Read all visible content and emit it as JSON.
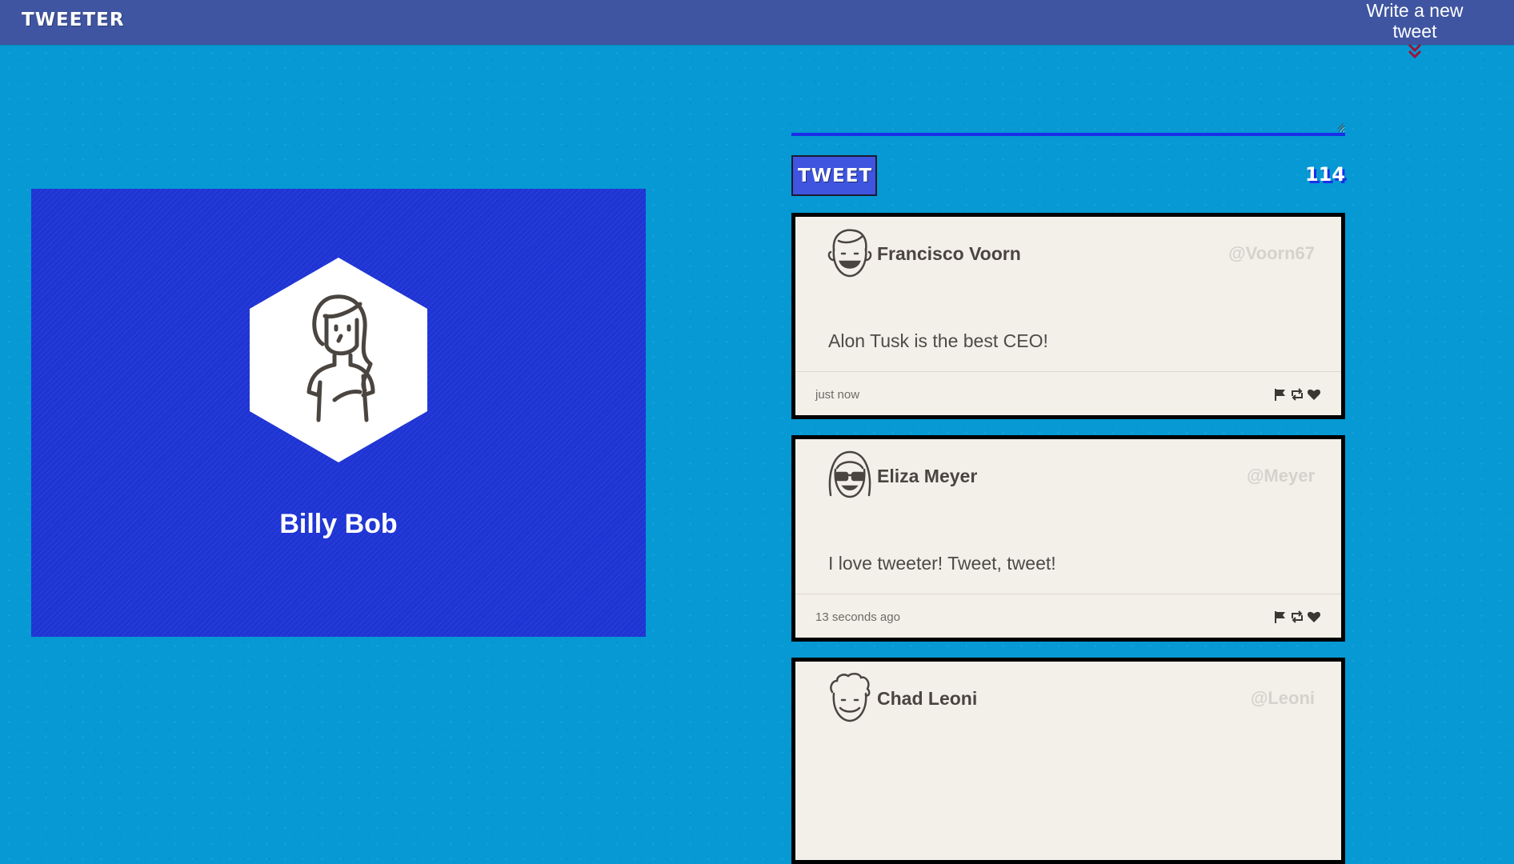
{
  "navbar": {
    "brand": "TWEETER",
    "compose_label": "Write a new tweet",
    "compose_icon": "double-chevron-down-icon",
    "chevron_color": "#a0123a"
  },
  "profile": {
    "name": "Billy Bob",
    "avatar_icon": "woman-avatar-icon"
  },
  "composer": {
    "textarea_value": "",
    "button_label": "TWEET",
    "char_count": "114"
  },
  "tweets": [
    {
      "name": "Francisco Voorn",
      "handle": "@Voorn67",
      "content": "Alon Tusk is the best CEO!",
      "time": "just now",
      "avatar_icon": "smiling-man-avatar-icon"
    },
    {
      "name": "Eliza Meyer",
      "handle": "@Meyer",
      "content": "I love tweeter! Tweet, tweet!",
      "time": "13 seconds ago",
      "avatar_icon": "woman-sunglasses-avatar-icon"
    },
    {
      "name": "Chad Leoni",
      "handle": "@Leoni",
      "content": "",
      "time": "",
      "avatar_icon": "curly-hair-man-avatar-icon"
    }
  ],
  "actions": [
    "flag-icon",
    "retweet-icon",
    "heart-icon"
  ],
  "colors": {
    "page_bg": "#0699d4",
    "navbar_bg": "#3f55a1",
    "profile_bg": "#1f35d6",
    "tweet_bg": "#f3f0ea",
    "button_bg": "#3f55e0",
    "accent_line": "#1a2ee8"
  }
}
